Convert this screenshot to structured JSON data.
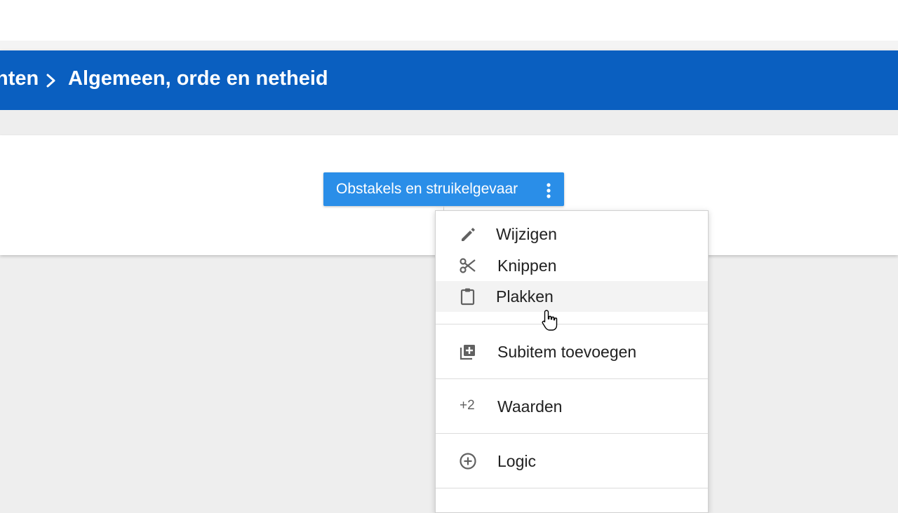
{
  "header": {
    "breadcrumb_prev": "nten",
    "breadcrumb_current": "Algemeen, orde en netheid",
    "separator_icon": "chevron-right-icon"
  },
  "item": {
    "label": "Obstakels en struikelgevaar",
    "more_icon": "more-vert-icon"
  },
  "menu": {
    "items": [
      {
        "label": "Wijzigen",
        "icon": "pencil-icon"
      },
      {
        "label": "Knippen",
        "icon": "scissors-icon"
      },
      {
        "label": "Plakken",
        "icon": "clipboard-icon"
      },
      {
        "label": "Subitem toevoegen",
        "icon": "add-subitem-icon"
      },
      {
        "label": "Waarden",
        "icon_text": "+2"
      },
      {
        "label": "Logic",
        "icon": "plus-circle-icon"
      }
    ]
  },
  "colors": {
    "header": "#0a5fc0",
    "chip": "#2a8ee8",
    "background": "#eeeeee"
  }
}
